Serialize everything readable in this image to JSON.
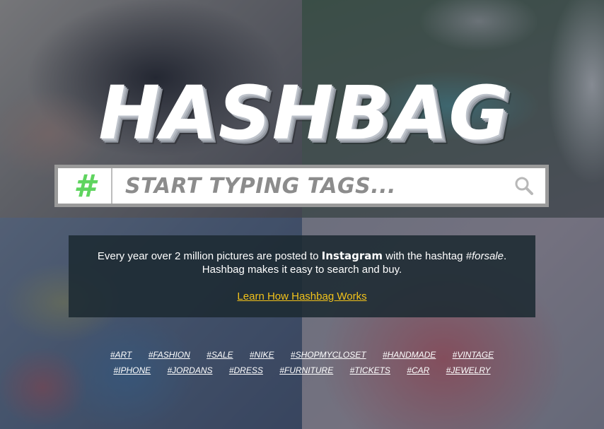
{
  "logo": {
    "text": "HASHBAG"
  },
  "search": {
    "hash_symbol": "#",
    "placeholder": "START TYPING TAGS...",
    "icon": "search-icon"
  },
  "info": {
    "line1_prefix": "Every year over 2 million pictures are posted to ",
    "line1_brand": "Instagram",
    "line1_middle": " with the hashtag ",
    "line1_tag": "#forsale",
    "line1_suffix": ".",
    "line2": "Hashbag makes it easy to search and buy.",
    "link_label": "Learn How Hashbag Works"
  },
  "tags": {
    "row1": [
      "#ART",
      "#FASHION",
      "#SALE",
      "#NIKE",
      "#SHOPMYCLOSET",
      "#HANDMADE",
      "#VINTAGE"
    ],
    "row2": [
      "#IPHONE",
      "#JORDANS",
      "#DRESS",
      "#FURNITURE",
      "#TICKETS",
      "#CAR",
      "#JEWELRY"
    ]
  },
  "colors": {
    "hash_green": "#5fd45f",
    "link_yellow": "#f2c21a",
    "panel_bg": "#1c2a32",
    "search_border": "#9a9a9a"
  }
}
